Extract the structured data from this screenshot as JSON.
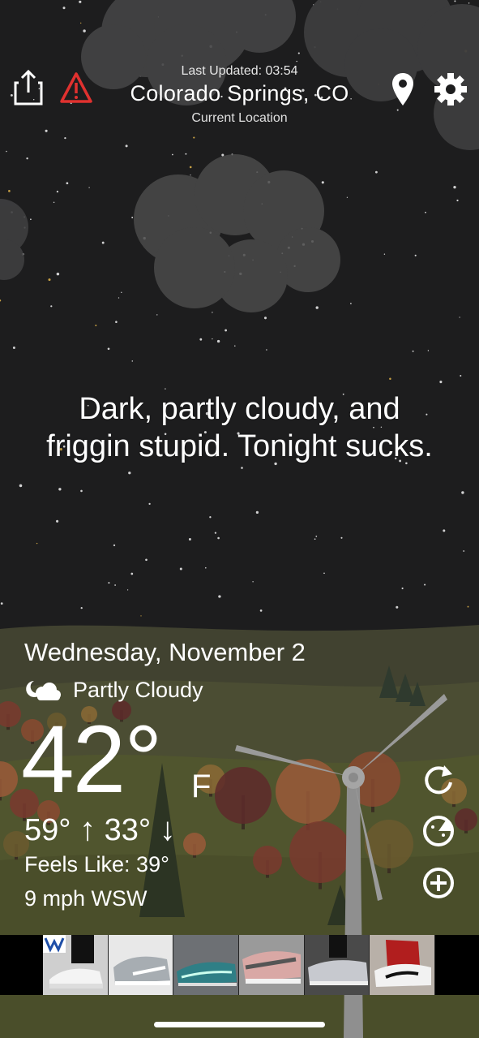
{
  "header": {
    "last_updated": "Last Updated: 03:54",
    "location": "Colorado Springs, CO",
    "location_sub": "Current Location",
    "icons": [
      "share-icon",
      "alert-icon",
      "location-pin-icon",
      "settings-gear-icon"
    ]
  },
  "quip": {
    "line1": "Dark, partly cloudy, and",
    "line2": "friggin stupid. Tonight sucks."
  },
  "weather": {
    "date": "Wednesday, November 2",
    "condition": "Partly Cloudy",
    "condition_icon": "partly-cloudy-night-icon",
    "temperature": "42°",
    "unit": "F",
    "high": "59°",
    "low": "33°",
    "high_arrow": "↑",
    "low_arrow": "↓",
    "feels_like": "Feels Like: 39°",
    "wind": "9 mph WSW"
  },
  "side_actions": [
    "refresh-icon",
    "radar-icon",
    "add-icon"
  ],
  "ad": {
    "tiles": [
      "sneaker-white-black",
      "sneaker-grey-white",
      "sneaker-teal",
      "sneaker-pink-grey",
      "sneaker-silver",
      "sneaker-red-white"
    ]
  },
  "colors": {
    "sky": "#1d1d1e",
    "cloud": "#6a6a6a",
    "hill": "#4a4a2e",
    "alert_red": "#e0312f"
  }
}
